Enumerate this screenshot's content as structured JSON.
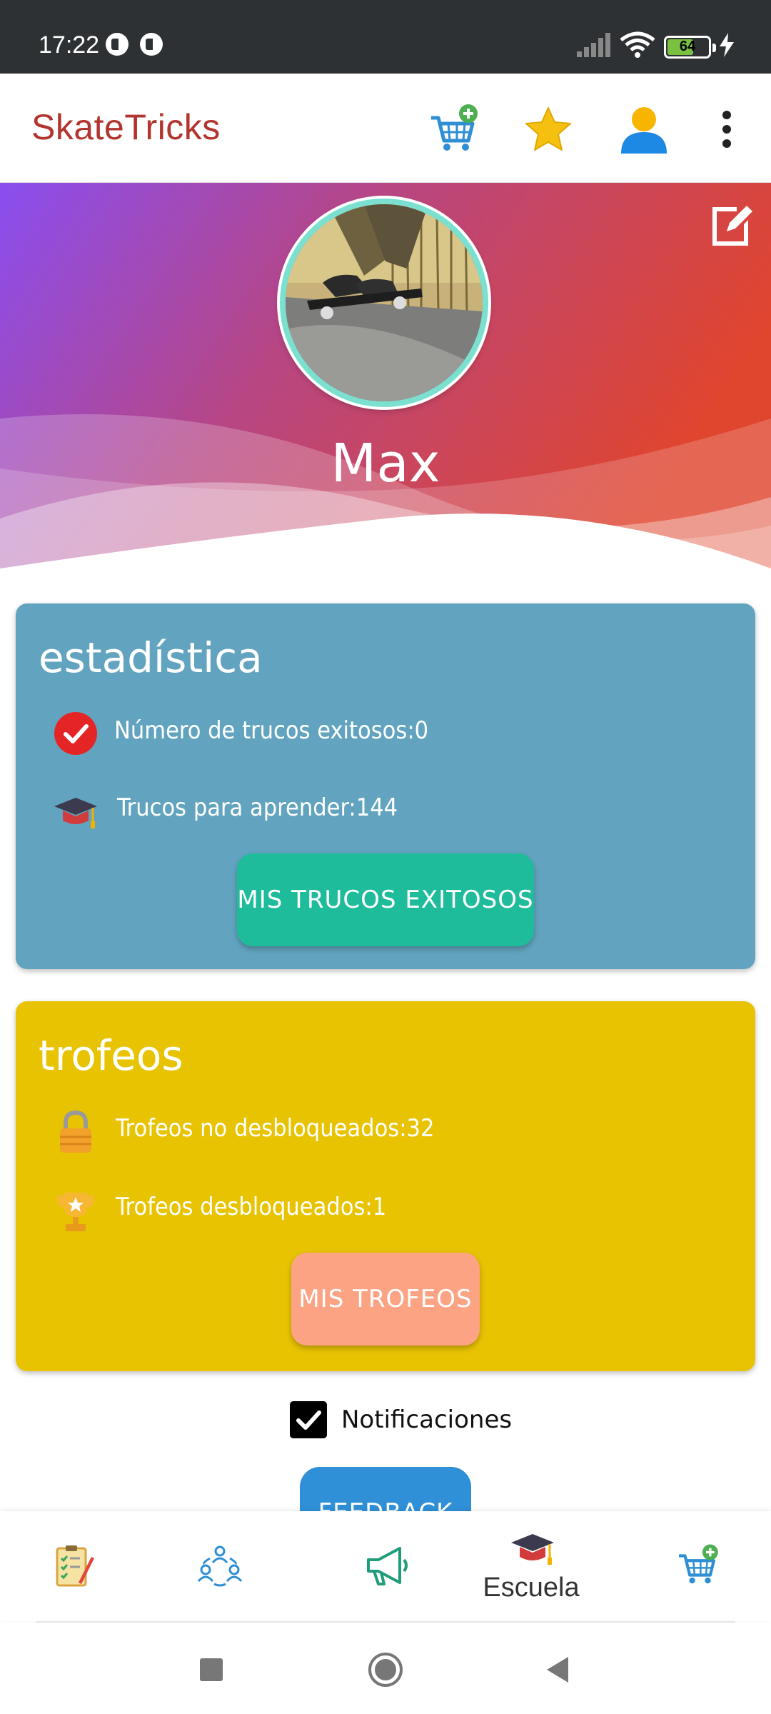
{
  "status_bar": {
    "time": "17:22",
    "battery": "64",
    "icons": [
      "notification-icon",
      "notification-icon",
      "signal-icon",
      "wifi-icon",
      "battery-icon",
      "charging-icon"
    ]
  },
  "app_bar": {
    "title": "SkateTricks",
    "actions": [
      "cart-add-icon",
      "star-icon",
      "user-icon",
      "more-vert-icon"
    ]
  },
  "profile": {
    "name": "Max",
    "avatar": "skateboarder-photo",
    "edit": "edit-icon"
  },
  "stats_card": {
    "title": "estadística",
    "successful_label": "Número de trucos exitosos:0",
    "to_learn_label": "Trucos para aprender:144",
    "button": "MIS TRUCOS EXITOSOS",
    "color": "#62a4bf"
  },
  "trophies_card": {
    "title": "trofeos",
    "locked_label": "Trofeos no desbloqueados:32",
    "unlocked_label": "Trofeos desbloqueados:1",
    "button": "MIS TROFEOS",
    "color": "#e8c302"
  },
  "notifications": {
    "label": "Notificaciones",
    "checked": true
  },
  "feedback_button": "FEEDBACK",
  "bottom_nav": {
    "items": [
      {
        "icon": "checklist-icon",
        "label": ""
      },
      {
        "icon": "community-icon",
        "label": ""
      },
      {
        "icon": "megaphone-icon",
        "label": ""
      },
      {
        "icon": "graduation-cap-icon",
        "label": "Escuela"
      },
      {
        "icon": "cart-add-icon",
        "label": ""
      }
    ]
  },
  "system_nav": [
    "recents-button",
    "home-button",
    "back-button"
  ]
}
